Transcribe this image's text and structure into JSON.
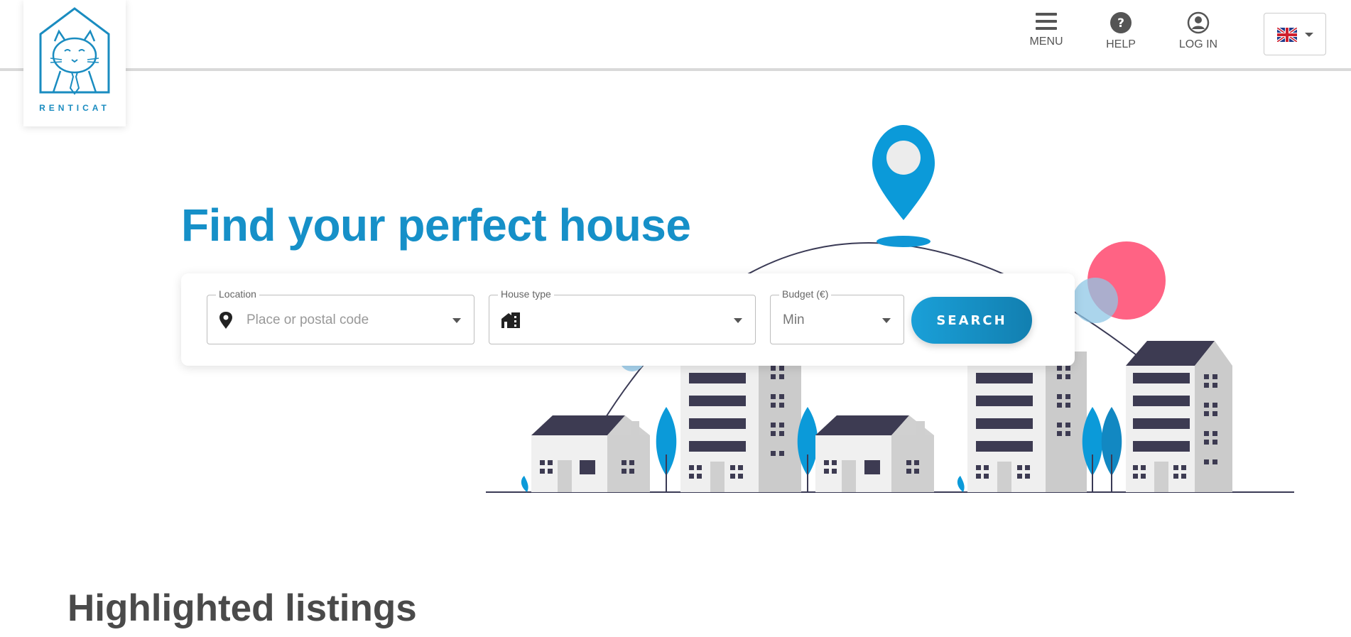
{
  "brand": {
    "name": "RENTICAT",
    "color": "#1a8cc0"
  },
  "nav": {
    "menu_label": "MENU",
    "help_label": "HELP",
    "login_label": "LOG IN",
    "language_icon": "uk-flag-icon"
  },
  "hero": {
    "title": "Find your perfect house",
    "title_color": "#1690c8"
  },
  "search": {
    "location": {
      "label": "Location",
      "placeholder": "Place or postal code"
    },
    "house_type": {
      "label": "House type",
      "value": ""
    },
    "budget": {
      "label": "Budget (€)",
      "value": "Min"
    },
    "button_label": "SEARCH"
  },
  "highlighted": {
    "title": "Highlighted listings"
  }
}
